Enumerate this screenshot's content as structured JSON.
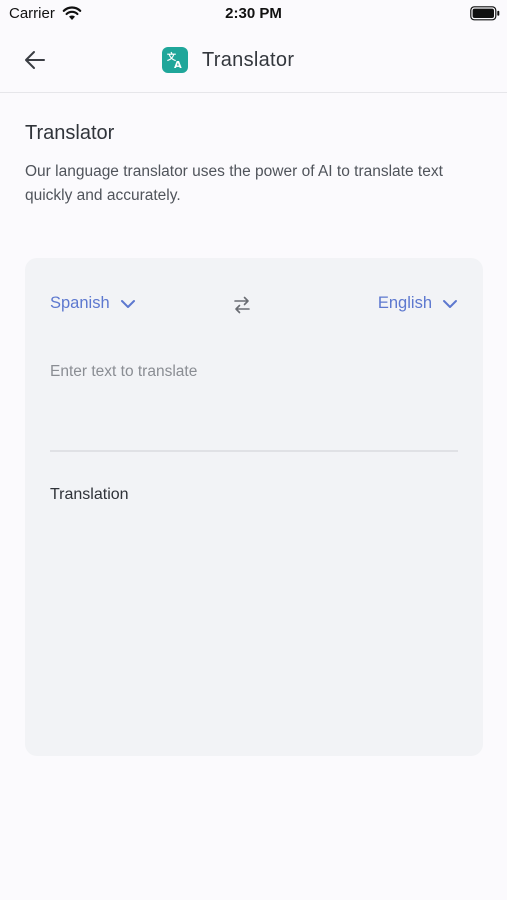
{
  "status_bar": {
    "carrier": "Carrier",
    "time": "2:30 PM",
    "icons": [
      "wifi-icon",
      "battery-icon"
    ]
  },
  "header": {
    "back_icon": "arrow-left-icon",
    "logo_icon": "translate-icon",
    "title": "Translator"
  },
  "intro": {
    "title": "Translator",
    "description": "Our language translator uses the power of AI to translate text quickly and accurately."
  },
  "translator": {
    "source_language": "Spanish",
    "target_language": "English",
    "swap_icon": "swap-arrows-icon",
    "dropdown_icon": "chevron-down-icon",
    "input_placeholder": "Enter text to translate",
    "input_value": "",
    "output_label": "Translation"
  },
  "colors": {
    "accent": "#5d78cf",
    "brand": "#1fa69a",
    "card_background": "#f2f3f6",
    "page_background": "#fbfafd"
  }
}
